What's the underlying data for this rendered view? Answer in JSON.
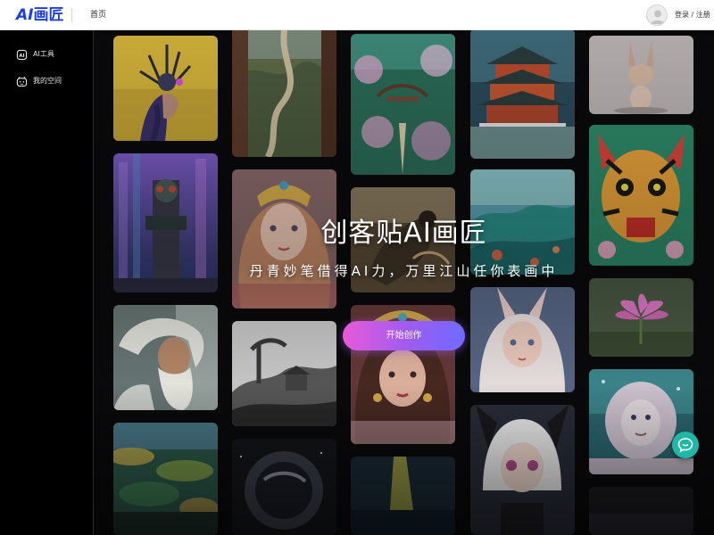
{
  "header": {
    "logo_ai": "AI",
    "logo_text": "画匠",
    "nav_home": "首页",
    "login_label": "登录 / 注册"
  },
  "sidebar": {
    "items": [
      {
        "label": "AI工具",
        "icon": "ai-chip-icon"
      },
      {
        "label": "我的空间",
        "icon": "robot-face-icon"
      }
    ]
  },
  "hero": {
    "title": "创客贴AI画匠",
    "subtitle": "丹青妙笔借得AI力，万里江山任你表画中",
    "cta_label": "开始创作"
  },
  "gallery": {
    "artworks": [
      {
        "name": "art-cyber-goddess",
        "colors": [
          "#d7b93a",
          "#2a2552"
        ]
      },
      {
        "name": "art-cyber-tower",
        "colors": [
          "#3a3b7a",
          "#8a5ec0"
        ]
      },
      {
        "name": "art-old-sage",
        "colors": [
          "#9aa8a6",
          "#2e3a3c"
        ]
      },
      {
        "name": "art-forest-blur",
        "colors": [
          "#3c6a48",
          "#c8b24e"
        ]
      },
      {
        "name": "art-great-wall",
        "colors": [
          "#6d6e52",
          "#2a2b22"
        ]
      },
      {
        "name": "art-crowned-princess",
        "colors": [
          "#d9a89a",
          "#7a4f4a"
        ]
      },
      {
        "name": "art-ink-landscape",
        "colors": [
          "#bdbdbd",
          "#3a3a3a"
        ]
      },
      {
        "name": "art-astronaut",
        "colors": [
          "#1c1d22",
          "#5a5e6a"
        ]
      },
      {
        "name": "art-flower-garden",
        "colors": [
          "#2d6a55",
          "#d9a7c4"
        ]
      },
      {
        "name": "art-fantasy-bird",
        "colors": [
          "#8a7a5e",
          "#3e3426"
        ]
      },
      {
        "name": "art-jeweled-lady",
        "colors": [
          "#c99a8a",
          "#4a2a2a"
        ]
      },
      {
        "name": "art-neon-water",
        "colors": [
          "#1e3040",
          "#c9c44a"
        ]
      },
      {
        "name": "art-pagoda",
        "colors": [
          "#b84a2e",
          "#1e3a4c"
        ]
      },
      {
        "name": "art-teal-hills",
        "colors": [
          "#2b8f8a",
          "#d5684a"
        ]
      },
      {
        "name": "art-bunny-girl",
        "colors": [
          "#e6c6c2",
          "#5a6a8a"
        ]
      },
      {
        "name": "art-anime-girl",
        "colors": [
          "#f2f2f2",
          "#2a2e3a"
        ]
      },
      {
        "name": "art-bunny-toy",
        "colors": [
          "#c7c2c2",
          "#6a5a52"
        ]
      },
      {
        "name": "art-tiger-folk",
        "colors": [
          "#2e8a6a",
          "#d9453a"
        ]
      },
      {
        "name": "art-lotus",
        "colors": [
          "#e67ad0",
          "#4a5a3a"
        ]
      },
      {
        "name": "art-white-lion",
        "colors": [
          "#d6cbd8",
          "#3e8a90"
        ]
      },
      {
        "name": "art-dark-tile",
        "colors": [
          "#1a1a1e",
          "#2e2e36"
        ]
      }
    ]
  },
  "chat": {
    "icon": "chat-bubble-icon",
    "color": "#1fb7a6"
  },
  "accent": {
    "cta_start": "#e85ad8",
    "cta_end": "#6f6bff",
    "logo": "#1e3fe0"
  }
}
